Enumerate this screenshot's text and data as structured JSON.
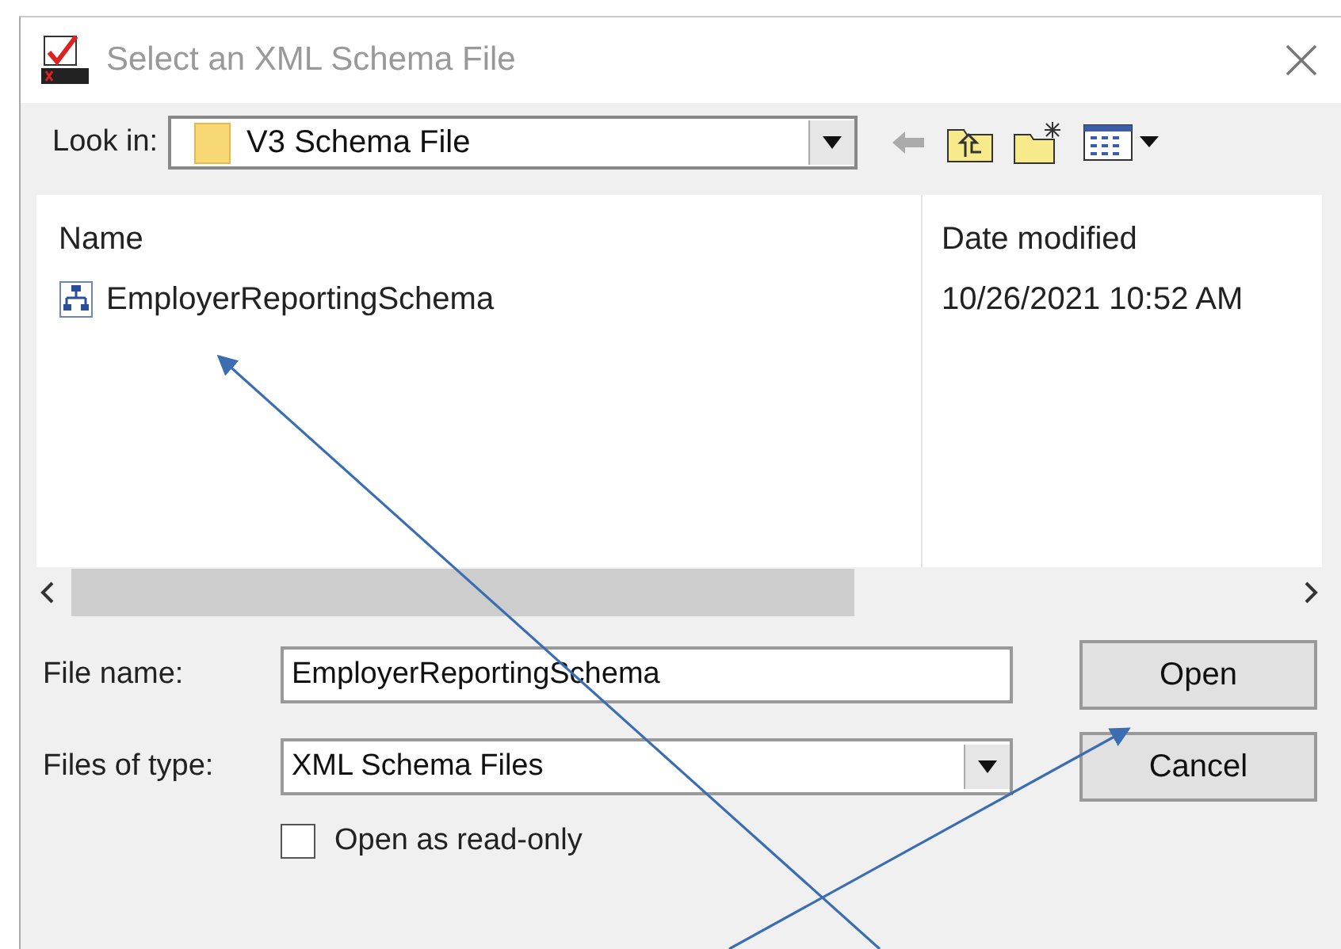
{
  "window": {
    "title": "Select an XML Schema File"
  },
  "look_in": {
    "label": "Look in:",
    "value": "V3 Schema File"
  },
  "file_list": {
    "columns": [
      "Name",
      "Date modified"
    ],
    "rows": [
      {
        "name": "EmployerReportingSchema",
        "date": "10/26/2021 10:52 AM"
      }
    ]
  },
  "file_name": {
    "label": "File name:",
    "value": "EmployerReportingSchema"
  },
  "files_of_type": {
    "label": "Files of type:",
    "value": "XML Schema Files"
  },
  "buttons": [
    "Open",
    "Cancel"
  ],
  "read_only": {
    "label": "Open as read-only",
    "checked": false
  }
}
